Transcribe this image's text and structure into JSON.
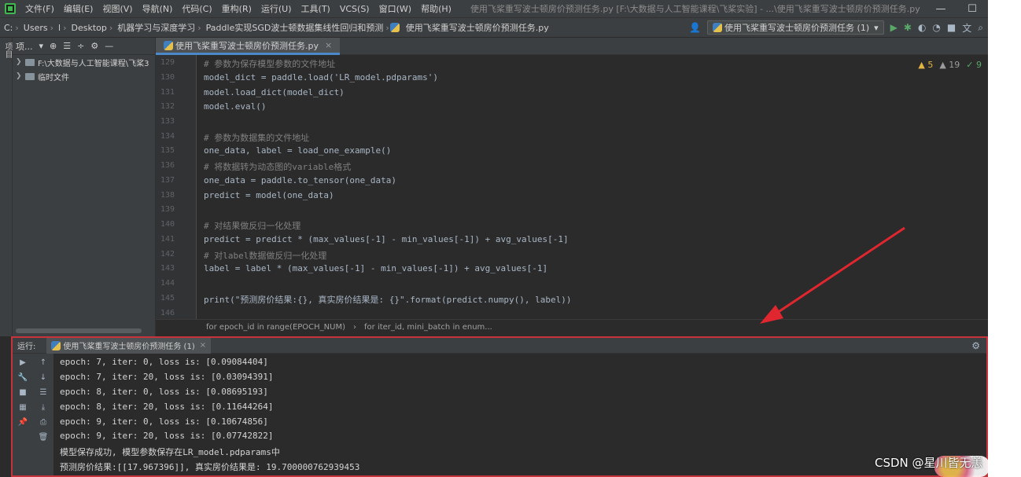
{
  "menubar": {
    "items": [
      "文件(F)",
      "编辑(E)",
      "视图(V)",
      "导航(N)",
      "代码(C)",
      "重构(R)",
      "运行(U)",
      "工具(T)",
      "VCS(S)",
      "窗口(W)",
      "帮助(H)"
    ],
    "window_title": "使用飞桨重写波士顿房价预测任务.py [F:\\大数据与人工智能课程\\飞桨实验] - ...\\使用飞桨重写波士顿房价预测任务.py",
    "minimize": "—",
    "maximize": "☐"
  },
  "navbar": {
    "crumbs": [
      "C:",
      "Users",
      "l",
      "Desktop",
      "机器学习与深度学习",
      "Paddle实现SGD波士顿数据集线性回归和预测",
      "使用飞桨重写波士顿房价预测任务.py"
    ],
    "run_config": "使用飞桨重写波士顿房价预测任务 (1)"
  },
  "left_strip": {
    "label": "项目"
  },
  "project": {
    "header": "项...",
    "tree": [
      {
        "label": "F:\\大数据与人工智能课程\\飞桨3"
      },
      {
        "label": "临时文件"
      }
    ]
  },
  "editor": {
    "tab": "使用飞桨重写波士顿房价预测任务.py",
    "tab_close": "×",
    "inspections": {
      "warnings": "5",
      "weak": "19",
      "ok": "9"
    },
    "line_numbers": [
      "129",
      "130",
      "131",
      "132",
      "133",
      "134",
      "135",
      "136",
      "137",
      "138",
      "139",
      "140",
      "141",
      "142",
      "143",
      "144",
      "145",
      "146"
    ],
    "lines": [
      "# 参数为保存模型参数的文件地址",
      "model_dict = paddle.load('LR_model.pdparams')",
      "model.load_dict(model_dict)",
      "model.eval()",
      "",
      "# 参数为数据集的文件地址",
      "one_data, label = load_one_example()",
      "# 将数据转为动态图的variable格式",
      "one_data = paddle.to_tensor(one_data)",
      "predict = model(one_data)",
      "",
      "# 对结果做反归一化处理",
      "predict = predict * (max_values[-1] - min_values[-1]) + avg_values[-1]",
      "# 对label数据做反归一化处理",
      "label = label * (max_values[-1] - min_values[-1]) + avg_values[-1]",
      "",
      "print(\"预测房价结果:{}, 真实房价结果是: {}\".format(predict.numpy(), label))",
      ""
    ],
    "breadcrumbs": [
      "for epoch_id in range(EPOCH_NUM)",
      "for iter_id, mini_batch in enum..."
    ]
  },
  "run": {
    "label": "运行:",
    "tab": "使用飞桨重写波士顿房价预测任务 (1)",
    "tab_close": "×",
    "output": [
      "epoch: 7, iter: 0, loss is: [0.09084404]",
      "epoch: 7, iter: 20, loss is: [0.03094391]",
      "epoch: 8, iter: 0, loss is: [0.08695193]",
      "epoch: 8, iter: 20, loss is: [0.11644264]",
      "epoch: 9, iter: 0, loss is: [0.10674856]",
      "epoch: 9, iter: 20, loss is: [0.07742822]",
      "模型保存成功, 模型参数保存在LR_model.pdparams中",
      "预测房价结果:[[17.967396]], 真实房价结果是: 19.700000762939453"
    ]
  },
  "watermark": "CSDN @星川皆无恙",
  "colors": {
    "highlight_border": "#c7333a",
    "arrow": "#e0262e",
    "accent": "#4a88c7"
  }
}
